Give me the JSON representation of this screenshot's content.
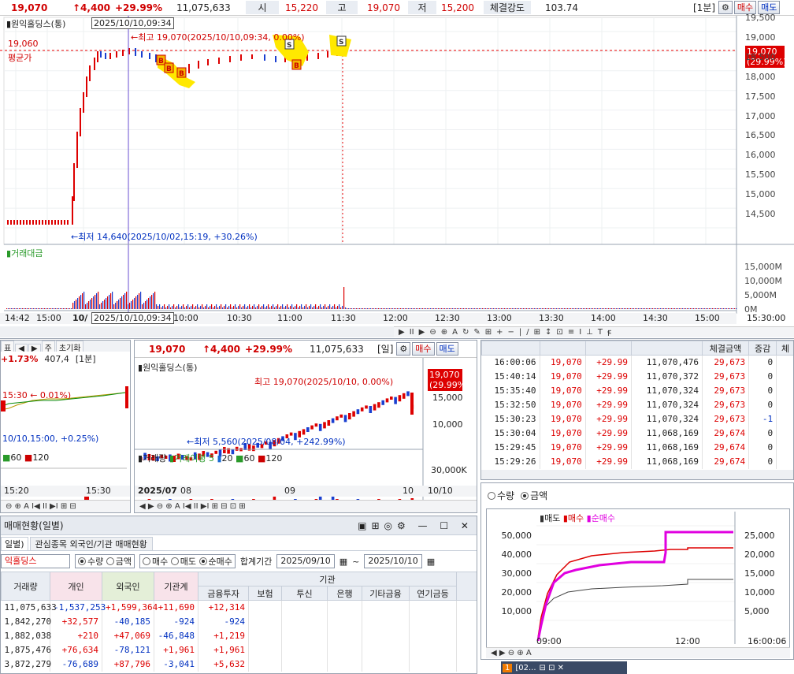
{
  "main_quote": {
    "price": "19,070",
    "change": "↑4,400",
    "rate": "+29.99%",
    "volume": "11,075,633",
    "open_lbl": "시",
    "open": "15,220",
    "high_lbl": "고",
    "high": "19,070",
    "low_lbl": "저",
    "low": "15,200",
    "strength_lbl": "체결강도",
    "strength": "103.74",
    "interval": "[1분]",
    "sell_btn": "매수",
    "buy_btn": "매도"
  },
  "main_chart": {
    "stock_name": "원익홀딩스(통)",
    "cursor_time": "2025/10/10,09:34",
    "max_label": "←최고 19,070(2025/10/10,09:34, 0.00%)",
    "min_label": "←최저 14,640(2025/10/02,15:19, +30.26%)",
    "avg_price": "19,060",
    "avg_label": "평균가",
    "price_tag": "19,070",
    "price_tag_rate": "(29.99%)",
    "yticks": [
      "19,500",
      "19,000",
      "18,500",
      "18,000",
      "17,500",
      "17,000",
      "16,500",
      "16,000",
      "15,500",
      "15,000",
      "14,500"
    ],
    "vol_title": "거래대금",
    "vol_yticks": [
      "15,000M",
      "10,000M",
      "5,000M",
      "0M"
    ],
    "xticks": [
      "14:42",
      "15:00",
      "10/",
      "10:00",
      "10:30",
      "11:00",
      "11:30",
      "12:00",
      "12:30",
      "13:00",
      "13:30",
      "14:00",
      "14:30",
      "15:00"
    ],
    "time_readout": "15:30:00",
    "cursor_x_label": "2025/10/10,09:34",
    "tools": [
      "▶",
      "II",
      "▶",
      "⊖",
      "⊕",
      "A",
      "↻",
      "✎",
      "⊞",
      "+",
      "−",
      "|",
      "/",
      "⊞",
      "↕",
      "⊡",
      "≡",
      "I",
      "⊥",
      "T",
      "Ꞙ"
    ]
  },
  "left_small": {
    "rate": "+1.73%",
    "vol": "407,4",
    "interval": "[1분]",
    "label1": "15:30",
    "label1_rate": "0.01%",
    "label2": "10/10,15:00, +0.25%)",
    "ma": [
      "60",
      "120"
    ],
    "xticks": [
      "15:20",
      "15:30"
    ],
    "top_tabs": [
      "표",
      "◀",
      "▶",
      "주",
      "초기화"
    ]
  },
  "daily_chart": {
    "price": "19,070",
    "change": "↑4,400",
    "rate": "+29.99%",
    "volume": "11,075,633",
    "interval": "[일]",
    "stock_name": "원익홀딩스(통)",
    "max_label": "최고 19,070(2025/10/10, 0.00%)",
    "min_label": "←최저 5,560(2025/08/04, +242.99%)",
    "price_tag": "19,070",
    "price_tag_rate": "(29.99%)",
    "yticks": [
      "15,000",
      "10,000"
    ],
    "vol_title": "거래량",
    "vol_ma": "거래이평",
    "vol_ma_vals": [
      "5",
      "20",
      "60",
      "120"
    ],
    "vol_ytick": "30,000K",
    "xticks": [
      "2025/07",
      "08",
      "09",
      "10",
      "10/10"
    ]
  },
  "trades": {
    "headers": [
      "",
      "",
      "",
      "",
      "체결금액",
      "증감",
      "체"
    ],
    "rows": [
      [
        "16:00:06",
        "19,070",
        "+29.99",
        "11,070,476",
        "29,673",
        "0"
      ],
      [
        "15:40:14",
        "19,070",
        "+29.99",
        "11,070,372",
        "29,673",
        "0"
      ],
      [
        "15:35:40",
        "19,070",
        "+29.99",
        "11,070,324",
        "29,673",
        "0"
      ],
      [
        "15:32:50",
        "19,070",
        "+29.99",
        "11,070,324",
        "29,673",
        "0"
      ],
      [
        "15:30:23",
        "19,070",
        "+29.99",
        "11,070,324",
        "29,673",
        "-1"
      ],
      [
        "15:30:04",
        "19,070",
        "+29.99",
        "11,068,169",
        "29,674",
        "0"
      ],
      [
        "15:29:45",
        "19,070",
        "+29.99",
        "11,068,169",
        "29,674",
        "0"
      ],
      [
        "15:29:26",
        "19,070",
        "+29.99",
        "11,068,169",
        "29,674",
        "0"
      ]
    ]
  },
  "flow_chart": {
    "radio_qty": "수량",
    "radio_amt": "금액",
    "legend": [
      "매도",
      "매수",
      "순매수"
    ],
    "y_left": [
      "50,000",
      "40,000",
      "30,000",
      "20,000",
      "10,000"
    ],
    "y_right": [
      "25,000",
      "20,000",
      "15,000",
      "10,000",
      "5,000"
    ],
    "xticks": [
      "09:00",
      "12:00",
      "16:00:06"
    ]
  },
  "investor": {
    "window_title": "매매현황(일별)",
    "tabs": [
      "일별)",
      "관심종목 외국인/기관 매매현황"
    ],
    "stock": "익홀딩스",
    "opts": [
      "수량",
      "금액",
      "매수",
      "매도",
      "순매수"
    ],
    "period_lbl": "합계기간",
    "date_from": "2025/09/10",
    "date_to": "2025/10/10",
    "inst_group": "기관",
    "headers": [
      "거래량",
      "개인",
      "외국인",
      "기관계",
      "금융투자",
      "보험",
      "투신",
      "은행",
      "기타금융",
      "연기금등"
    ],
    "rows": [
      [
        "11,075,633",
        "-1,537,253",
        "+1,599,364",
        "+11,690",
        "+12,314"
      ],
      [
        "1,842,270",
        "+32,577",
        "-40,185",
        "-924",
        "-924"
      ],
      [
        "1,882,038",
        "+210",
        "+47,069",
        "-46,848",
        "+1,219"
      ],
      [
        "1,875,476",
        "+76,634",
        "-78,121",
        "+1,961",
        "+1,961"
      ],
      [
        "3,872,279",
        "-76,689",
        "+87,796",
        "-3,041",
        "+5,632"
      ]
    ]
  },
  "taskbar": {
    "tab": "[02..."
  }
}
